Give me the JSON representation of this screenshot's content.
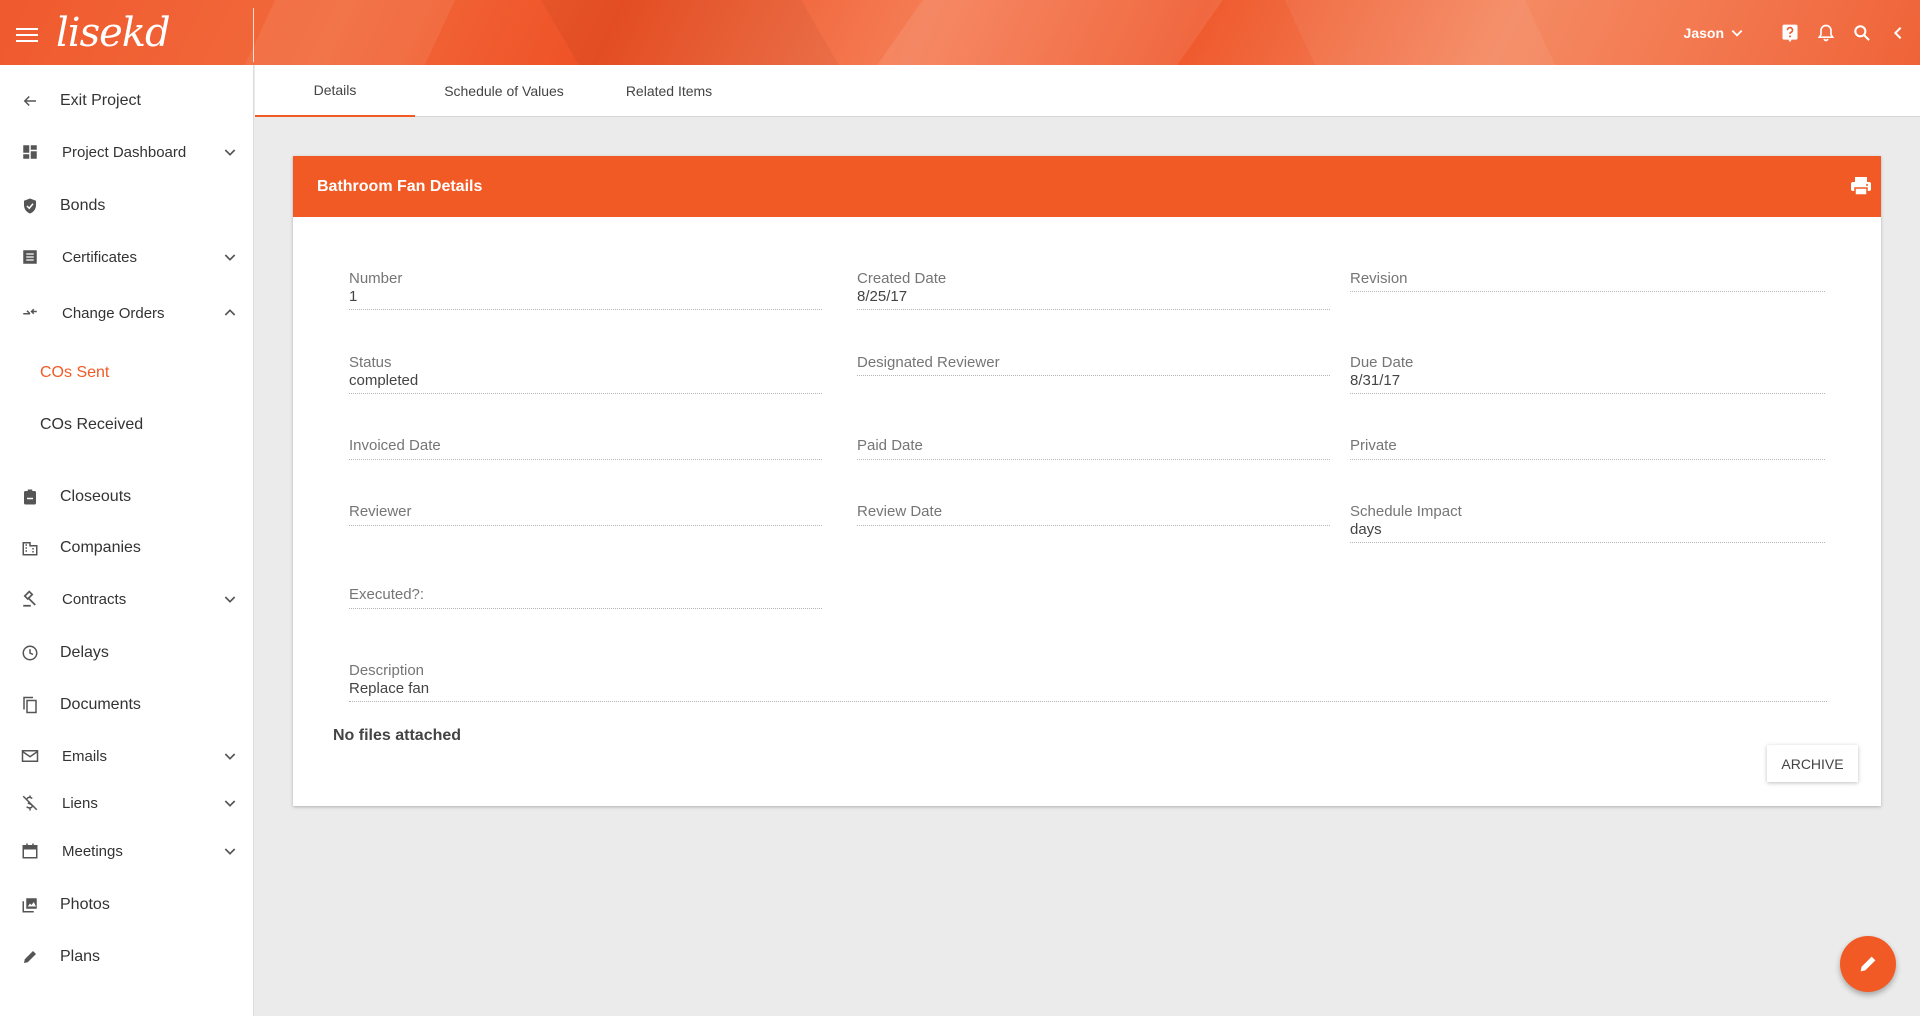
{
  "app": {
    "logo_text": "lisekd",
    "user_name": "Jason"
  },
  "icons": {
    "menu": "hamburger-icon",
    "help": "help-icon",
    "notifications": "bell-icon",
    "search": "search-icon",
    "collapse": "chevron-left-icon"
  },
  "sidebar": {
    "items": [
      {
        "label": "Exit Project",
        "icon": "arrow-left-icon"
      },
      {
        "label": "Project Dashboard",
        "icon": "dashboard-icon",
        "expandable": true
      },
      {
        "label": "Bonds",
        "icon": "shield-icon"
      },
      {
        "label": "Certificates",
        "icon": "list-icon",
        "expandable": true
      },
      {
        "label": "Change Orders",
        "icon": "swap-icon",
        "expanded": true
      },
      {
        "label": "Closeouts",
        "icon": "clipboard-icon"
      },
      {
        "label": "Companies",
        "icon": "building-icon"
      },
      {
        "label": "Contracts",
        "icon": "gavel-icon",
        "expandable": true
      },
      {
        "label": "Delays",
        "icon": "clock-icon"
      },
      {
        "label": "Documents",
        "icon": "copy-icon"
      },
      {
        "label": "Emails",
        "icon": "mail-icon",
        "expandable": true
      },
      {
        "label": "Liens",
        "icon": "money-off-icon",
        "expandable": true
      },
      {
        "label": "Meetings",
        "icon": "calendar-icon",
        "expandable": true
      },
      {
        "label": "Photos",
        "icon": "photo-library-icon"
      },
      {
        "label": "Plans",
        "icon": "pencil-icon"
      }
    ],
    "sub_items": [
      {
        "label": "COs Sent",
        "active": true
      },
      {
        "label": "COs Received",
        "active": false
      }
    ]
  },
  "tabs": [
    {
      "label": "Details",
      "active": true
    },
    {
      "label": "Schedule of Values",
      "active": false
    },
    {
      "label": "Related Items",
      "active": false
    }
  ],
  "card": {
    "title": "Bathroom Fan Details",
    "fields": {
      "number": {
        "label": "Number",
        "value": "1"
      },
      "created_date": {
        "label": "Created Date",
        "value": "8/25/17"
      },
      "revision": {
        "label": "Revision",
        "value": ""
      },
      "status": {
        "label": "Status",
        "value": "completed"
      },
      "designated_reviewer": {
        "label": "Designated Reviewer",
        "value": ""
      },
      "due_date": {
        "label": "Due Date",
        "value": "8/31/17"
      },
      "invoiced_date": {
        "label": "Invoiced Date",
        "value": ""
      },
      "paid_date": {
        "label": "Paid Date",
        "value": ""
      },
      "private": {
        "label": "Private",
        "value": ""
      },
      "reviewer": {
        "label": "Reviewer",
        "value": ""
      },
      "review_date": {
        "label": "Review Date",
        "value": ""
      },
      "schedule_impact": {
        "label": "Schedule Impact",
        "value": "days"
      },
      "executed": {
        "label": "Executed?:",
        "value": ""
      },
      "description": {
        "label": "Description",
        "value": "Replace fan"
      }
    },
    "no_files_text": "No files attached",
    "archive_label": "ARCHIVE"
  },
  "colors": {
    "brand": "#f15a24",
    "active_text": "#f15a24"
  }
}
